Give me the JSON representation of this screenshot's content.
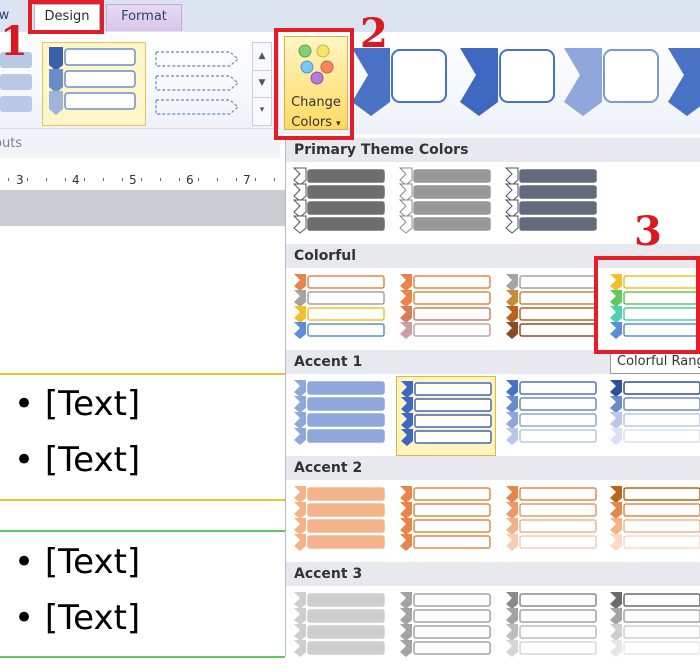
{
  "tabs": {
    "view_partial": "w",
    "design": "Design",
    "format": "Format"
  },
  "ribbon": {
    "group_label": "outs",
    "change_colors_line1": "Change",
    "change_colors_line2": "Colors",
    "scroll_icons": [
      "scroll-up-icon",
      "scroll-down-icon",
      "more-icon"
    ]
  },
  "annotations": {
    "step1": "1",
    "step2": "2",
    "step3": "3"
  },
  "ruler": {
    "ticks": [
      "3",
      "4",
      "5",
      "6",
      "7"
    ]
  },
  "document": {
    "bullets": [
      "[Text]",
      "[Text]",
      "[Text]",
      "[Text]"
    ]
  },
  "gallery": {
    "sections": [
      "Primary Theme Colors",
      "Colorful",
      "Accent 1",
      "Accent 2",
      "Accent 3"
    ],
    "tooltip": "Colorful Range"
  },
  "colors": {
    "highlight_red": "#e31e26",
    "accent1": "#4a72c4",
    "accent2": "#e5874a",
    "accent3": "#a3a3a3",
    "selection": "#fff3c0"
  }
}
